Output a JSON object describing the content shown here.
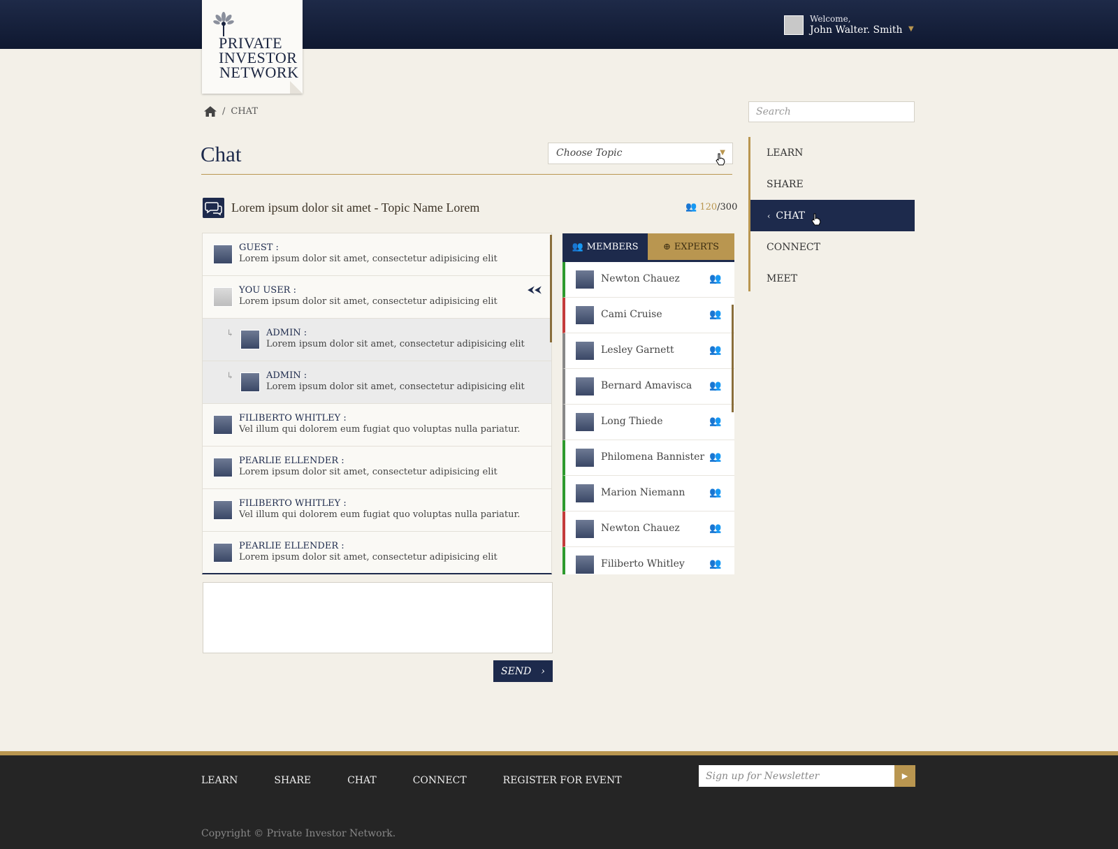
{
  "header": {
    "logo_lines": [
      "PRIVATE",
      "INVESTOR",
      "NETWORK"
    ],
    "welcome_label": "Welcome,",
    "user_name": "John Walter. Smith"
  },
  "breadcrumb": {
    "current": "CHAT"
  },
  "search": {
    "placeholder": "Search"
  },
  "page": {
    "title": "Chat",
    "topic_select": "Choose Topic",
    "topic_title": "Lorem ipsum dolor sit amet - Topic Name Lorem",
    "online_count": "120",
    "total_count": "/300"
  },
  "messages": [
    {
      "name": "GUEST :",
      "text": "Lorem ipsum dolor sit amet, consectetur adipisicing elit"
    },
    {
      "name": "YOU USER :",
      "text": "Lorem ipsum dolor sit amet, consectetur adipisicing elit"
    },
    {
      "name": "ADMIN :",
      "text": "Lorem ipsum dolor sit amet, consectetur adipisicing elit"
    },
    {
      "name": "ADMIN :",
      "text": "Lorem ipsum dolor sit amet, consectetur adipisicing elit"
    },
    {
      "name": "FILIBERTO WHITLEY :",
      "text": "Vel illum qui dolorem eum fugiat quo voluptas nulla pariatur."
    },
    {
      "name": "PEARLIE ELLENDER :",
      "text": "Lorem ipsum dolor sit amet, consectetur adipisicing elit"
    },
    {
      "name": "FILIBERTO WHITLEY :",
      "text": "Vel illum qui dolorem eum fugiat quo voluptas nulla pariatur."
    },
    {
      "name": "PEARLIE ELLENDER :",
      "text": "Lorem ipsum dolor sit amet, consectetur adipisicing elit"
    }
  ],
  "member_tabs": {
    "members": "MEMBERS",
    "experts": "EXPERTS"
  },
  "members": [
    {
      "name": "Newton Chauez",
      "status": "online"
    },
    {
      "name": "Cami Cruise",
      "status": "busy"
    },
    {
      "name": "Lesley Garnett",
      "status": "offline"
    },
    {
      "name": "Bernard Amavisca",
      "status": "offline"
    },
    {
      "name": "Long Thiede",
      "status": "offline"
    },
    {
      "name": "Philomena Bannister",
      "status": "online"
    },
    {
      "name": "Marion Niemann",
      "status": "online"
    },
    {
      "name": "Newton Chauez",
      "status": "busy"
    },
    {
      "name": "Filiberto Whitley",
      "status": "online"
    }
  ],
  "compose": {
    "send_label": "SEND"
  },
  "sidenav": [
    "LEARN",
    "SHARE",
    "CHAT",
    "CONNECT",
    "MEET"
  ],
  "footer": {
    "nav": [
      "LEARN",
      "SHARE",
      "CHAT",
      "CONNECT",
      "REGISTER FOR EVENT"
    ],
    "newsletter_placeholder": "Sign up for Newsletter",
    "copyright": "Copyright © Private Investor Network."
  },
  "colors": {
    "navy": "#1d2a4c",
    "gold": "#b99650",
    "online": "#2e9a2e",
    "busy": "#c43b3b",
    "offline": "#888888"
  },
  "icons": [
    "home-icon",
    "chat-bubbles-icon",
    "users-icon",
    "reply-icon",
    "back-arrows-icon",
    "globe-icon",
    "chevron-left-icon",
    "chevron-right-icon",
    "play-icon",
    "hand-cursor-icon"
  ]
}
